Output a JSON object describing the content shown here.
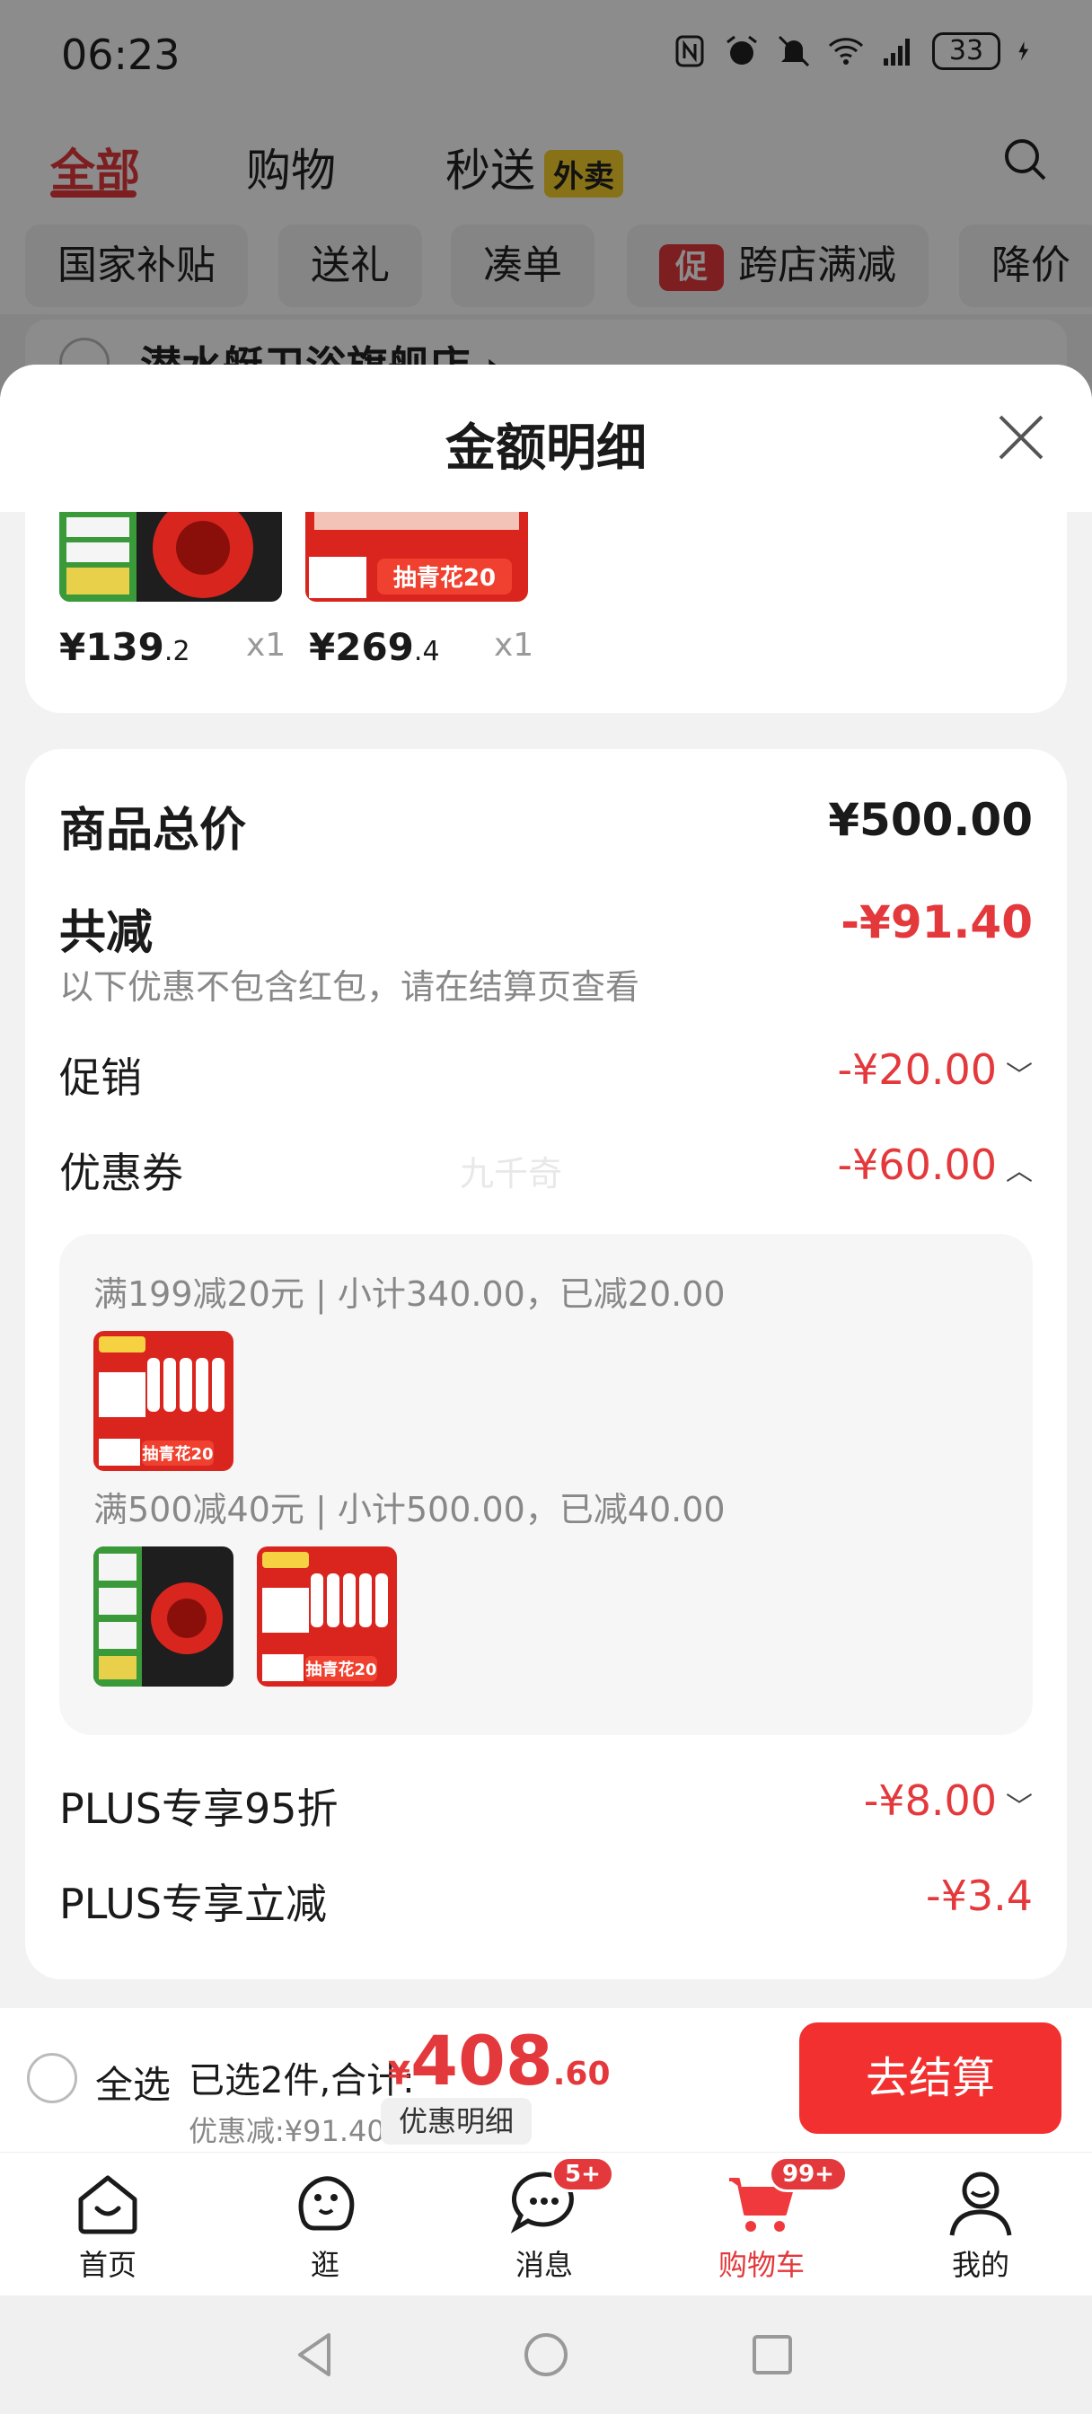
{
  "status": {
    "time": "06:23",
    "battery": "33"
  },
  "background": {
    "tabs": [
      "全部",
      "购物",
      "秒送"
    ],
    "waimai_badge": "外卖",
    "chips": [
      "国家补贴",
      "送礼",
      "凑单",
      "跨店满减",
      "降价"
    ],
    "cu_badge": "促",
    "store_name": "潜水艇卫浴旗舰店 ›"
  },
  "sheet": {
    "title": "金额明细",
    "top_products": [
      {
        "price_int": "¥139",
        "price_dec": ".2",
        "qty": "x1"
      },
      {
        "price_int": "¥269",
        "price_dec": ".4",
        "qty": "x1"
      }
    ],
    "product_overlay_text": "抽青花20",
    "total_label": "商品总价",
    "total_value": "¥500.00",
    "reduce_label": "共减",
    "reduce_value": "-¥91.40",
    "reduce_note": "以下优惠不包含红包，请在结算页查看",
    "promo_label": "促销",
    "promo_value": "-¥20.00",
    "coupon_label": "优惠券",
    "coupon_value": "-¥60.00",
    "watermark": "九千奇",
    "coupon_rules": [
      "满199减20元 | 小计340.00，已减20.00",
      "满500减40元 | 小计500.00，已减40.00"
    ],
    "plus95_label": "PLUS专享95折",
    "plus95_value": "-¥8.00",
    "plusdirect_label": "PLUS专享立减",
    "plusdirect_value": "-¥3.4"
  },
  "checkout": {
    "select_all": "全选",
    "selected_text": "已选2件,合计:",
    "total_currency": "¥",
    "total_int": "408",
    "total_dec": ".60",
    "discount_text": "优惠减:¥91.40",
    "detail_button": "优惠明细",
    "checkout_button": "去结算"
  },
  "nav": {
    "items": [
      {
        "label": "首页",
        "icon": "home-icon"
      },
      {
        "label": "逛",
        "icon": "explore-icon"
      },
      {
        "label": "消息",
        "icon": "message-icon",
        "badge": "5+"
      },
      {
        "label": "购物车",
        "icon": "cart-icon",
        "badge": "99+"
      },
      {
        "label": "我的",
        "icon": "profile-icon"
      }
    ]
  },
  "colors": {
    "accent": "#e4393c",
    "checkout_button": "#f23030"
  }
}
